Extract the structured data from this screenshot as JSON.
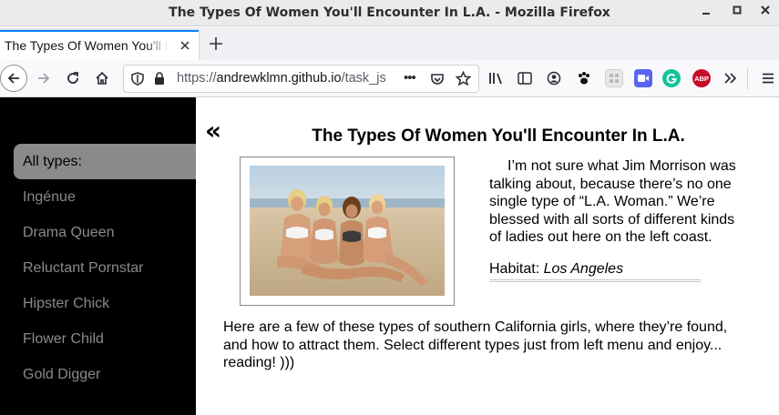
{
  "window": {
    "title": "The Types Of Women You'll Encounter In L.A. - Mozilla Firefox"
  },
  "tab": {
    "title": "The Types Of Women You'll Encounter In L.A."
  },
  "urlbar": {
    "scheme": "https://",
    "domain": "andrewklmn.github.io",
    "path": "/task_js",
    "more": "•••"
  },
  "extensions": {
    "abp_label": "ABP"
  },
  "sidebar": {
    "items": [
      {
        "label": "All types:",
        "active": true
      },
      {
        "label": "Ingénue"
      },
      {
        "label": "Drama Queen"
      },
      {
        "label": "Reluctant Pornstar"
      },
      {
        "label": "Hipster Chick"
      },
      {
        "label": "Flower Child"
      },
      {
        "label": "Gold Digger"
      }
    ]
  },
  "content": {
    "back_glyph": "«",
    "heading": "The Types Of Women You'll Encounter In L.A.",
    "intro": "I’m not sure what Jim Morrison was talking about, because there’s no one single type of “L.A. Woman.” We’re blessed with all sorts of different kinds of ladies out here on the left coast.",
    "habitat_label": "Habitat:",
    "habitat_value": "Los Angeles",
    "description": "Here are a few of these types of southern California girls, where they’re found, and how to attract them. Select different types just from left menu and enjoy... reading! )))"
  },
  "colors": {
    "sidebar_bg": "#000000",
    "menu_text": "#8a8a8a",
    "menu_active_bg": "#8a8a8a",
    "accent": "#0a84ff"
  }
}
